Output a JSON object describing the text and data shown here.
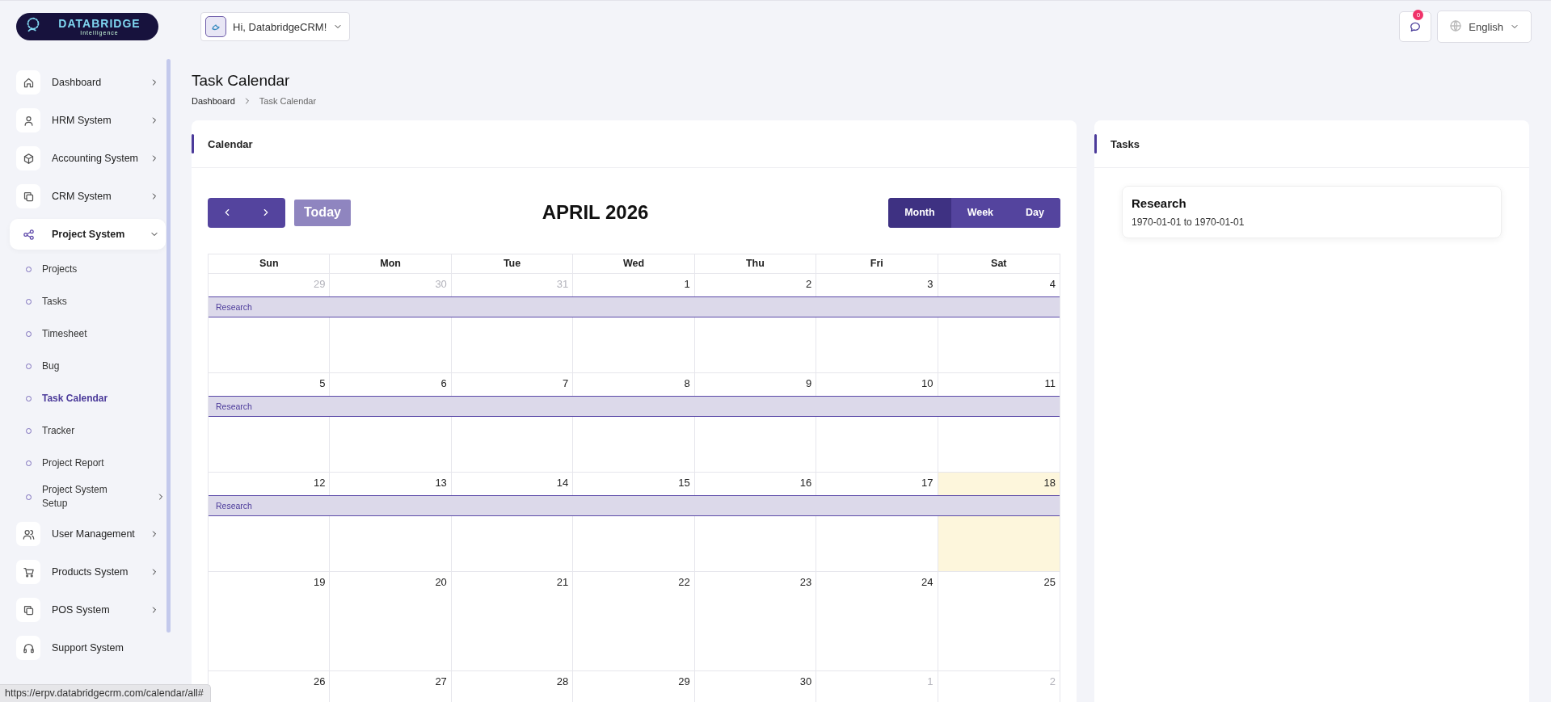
{
  "logo": {
    "title": "DATABRIDGE",
    "subtitle": "Intelligence"
  },
  "user_menu": {
    "greeting": "Hi, DatabridgeCRM!"
  },
  "notifications": {
    "count": "0"
  },
  "language": {
    "label": "English"
  },
  "sidebar": {
    "items": [
      {
        "label": "Dashboard",
        "selected": false,
        "expandable": true,
        "expanded": false
      },
      {
        "label": "HRM System",
        "selected": false,
        "expandable": true,
        "expanded": false
      },
      {
        "label": "Accounting System",
        "selected": false,
        "expandable": true,
        "expanded": false
      },
      {
        "label": "CRM System",
        "selected": false,
        "expandable": true,
        "expanded": false
      },
      {
        "label": "Project System",
        "selected": true,
        "expandable": true,
        "expanded": true,
        "children": [
          {
            "label": "Projects",
            "selected": false,
            "expandable": false
          },
          {
            "label": "Tasks",
            "selected": false,
            "expandable": false
          },
          {
            "label": "Timesheet",
            "selected": false,
            "expandable": false
          },
          {
            "label": "Bug",
            "selected": false,
            "expandable": false
          },
          {
            "label": "Task Calendar",
            "selected": true,
            "expandable": false
          },
          {
            "label": "Tracker",
            "selected": false,
            "expandable": false
          },
          {
            "label": "Project Report",
            "selected": false,
            "expandable": false
          },
          {
            "label": "Project System Setup",
            "selected": false,
            "expandable": true
          }
        ]
      },
      {
        "label": "User Management",
        "selected": false,
        "expandable": true,
        "expanded": false
      },
      {
        "label": "Products System",
        "selected": false,
        "expandable": true,
        "expanded": false
      },
      {
        "label": "POS System",
        "selected": false,
        "expandable": true,
        "expanded": false
      },
      {
        "label": "Support System",
        "selected": false,
        "expandable": false
      }
    ]
  },
  "page": {
    "title": "Task Calendar",
    "breadcrumbs": [
      "Dashboard",
      "Task Calendar"
    ]
  },
  "calendar": {
    "card_title": "Calendar",
    "today_button": {
      "label": "Today",
      "disabled": true
    },
    "title": "APRIL 2026",
    "views": [
      {
        "label": "Month",
        "selected": true
      },
      {
        "label": "Week",
        "selected": false
      },
      {
        "label": "Day",
        "selected": false
      }
    ],
    "weekdays": [
      "Sun",
      "Mon",
      "Tue",
      "Wed",
      "Thu",
      "Fri",
      "Sat"
    ],
    "weeks": [
      {
        "days": [
          {
            "label": "29",
            "other_month": true,
            "today": false
          },
          {
            "label": "30",
            "other_month": true,
            "today": false
          },
          {
            "label": "31",
            "other_month": true,
            "today": false
          },
          {
            "label": "1",
            "other_month": false,
            "today": false
          },
          {
            "label": "2",
            "other_month": false,
            "today": false
          },
          {
            "label": "3",
            "other_month": false,
            "today": false
          },
          {
            "label": "4",
            "other_month": false,
            "today": false
          }
        ],
        "events": [
          {
            "title": "Research"
          }
        ]
      },
      {
        "days": [
          {
            "label": "5",
            "other_month": false,
            "today": false
          },
          {
            "label": "6",
            "other_month": false,
            "today": false
          },
          {
            "label": "7",
            "other_month": false,
            "today": false
          },
          {
            "label": "8",
            "other_month": false,
            "today": false
          },
          {
            "label": "9",
            "other_month": false,
            "today": false
          },
          {
            "label": "10",
            "other_month": false,
            "today": false
          },
          {
            "label": "11",
            "other_month": false,
            "today": false
          }
        ],
        "events": [
          {
            "title": "Research"
          }
        ]
      },
      {
        "days": [
          {
            "label": "12",
            "other_month": false,
            "today": false
          },
          {
            "label": "13",
            "other_month": false,
            "today": false
          },
          {
            "label": "14",
            "other_month": false,
            "today": false
          },
          {
            "label": "15",
            "other_month": false,
            "today": false
          },
          {
            "label": "16",
            "other_month": false,
            "today": false
          },
          {
            "label": "17",
            "other_month": false,
            "today": false
          },
          {
            "label": "18",
            "other_month": false,
            "today": true
          }
        ],
        "events": [
          {
            "title": "Research"
          }
        ]
      },
      {
        "days": [
          {
            "label": "19",
            "other_month": false,
            "today": false
          },
          {
            "label": "20",
            "other_month": false,
            "today": false
          },
          {
            "label": "21",
            "other_month": false,
            "today": false
          },
          {
            "label": "22",
            "other_month": false,
            "today": false
          },
          {
            "label": "23",
            "other_month": false,
            "today": false
          },
          {
            "label": "24",
            "other_month": false,
            "today": false
          },
          {
            "label": "25",
            "other_month": false,
            "today": false
          }
        ]
      },
      {
        "days": [
          {
            "label": "26",
            "other_month": false,
            "today": false
          },
          {
            "label": "27",
            "other_month": false,
            "today": false
          },
          {
            "label": "28",
            "other_month": false,
            "today": false
          },
          {
            "label": "29",
            "other_month": false,
            "today": false
          },
          {
            "label": "30",
            "other_month": false,
            "today": false
          },
          {
            "label": "1",
            "other_month": true,
            "today": false
          },
          {
            "label": "2",
            "other_month": true,
            "today": false
          }
        ]
      }
    ]
  },
  "tasks": {
    "card_title": "Tasks",
    "items": [
      {
        "title": "Research",
        "dates": "1970-01-01 to 1970-01-01"
      }
    ]
  },
  "status_bar": {
    "url": "https://erpv.databridgecrm.com/calendar/all#"
  }
}
